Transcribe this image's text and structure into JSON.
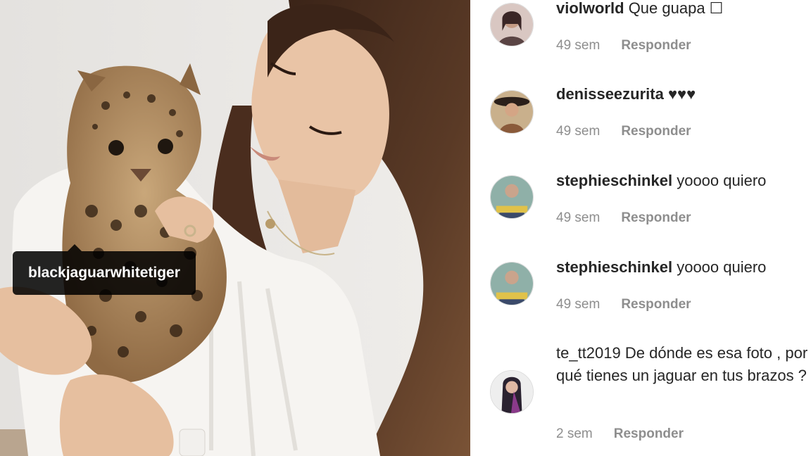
{
  "photo": {
    "tag_label": "blackjaguarwhitetiger"
  },
  "comments": [
    {
      "username": "violworld",
      "text": "Que guapa ☐",
      "time": "49 sem",
      "reply_label": "Responder"
    },
    {
      "username": "denisseezurita",
      "text": "♥♥♥",
      "time": "49 sem",
      "reply_label": "Responder"
    },
    {
      "username": "stephieschinkel",
      "text": "yoooo quiero",
      "time": "49 sem",
      "reply_label": "Responder"
    },
    {
      "username": "stephieschinkel",
      "text": "yoooo quiero",
      "time": "49 sem",
      "reply_label": "Responder"
    },
    {
      "username": "te_tt2019",
      "text": "De dónde es esa foto , por qué tienes un jaguar en tus brazos ?",
      "time": "2 sem",
      "reply_label": "Responder"
    }
  ],
  "colors": {
    "username": "#262626",
    "text": "#262626",
    "meta": "#8e8e8e",
    "tag_bg": "#000000"
  }
}
